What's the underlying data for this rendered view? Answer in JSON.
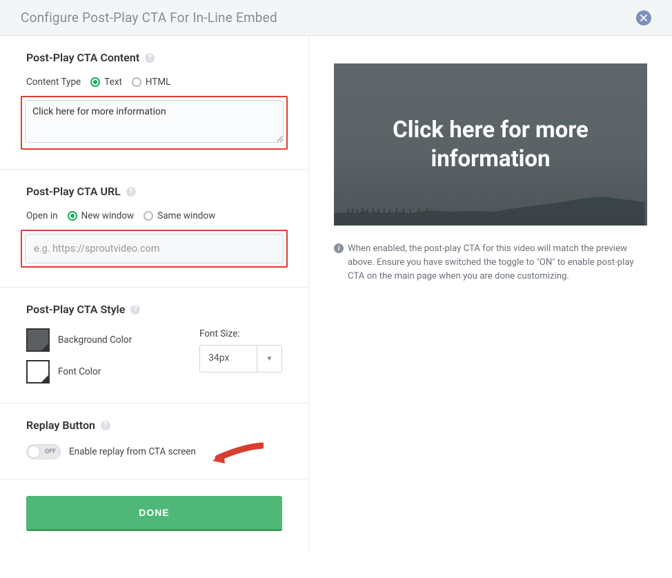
{
  "header": {
    "title": "Configure Post-Play CTA For In-Line Embed"
  },
  "ctaContent": {
    "title": "Post-Play CTA Content",
    "contentTypeLabel": "Content Type",
    "options": {
      "text": "Text",
      "html": "HTML"
    },
    "textValue": "Click here for more information"
  },
  "ctaUrl": {
    "title": "Post-Play CTA URL",
    "openInLabel": "Open in",
    "options": {
      "newWindow": "New window",
      "sameWindow": "Same window"
    },
    "placeholder": "e.g. https://sproutvideo.com"
  },
  "ctaStyle": {
    "title": "Post-Play CTA Style",
    "bgColorLabel": "Background Color",
    "fontColorLabel": "Font Color",
    "fontSizeLabel": "Font Size:",
    "fontSizeValue": "34px"
  },
  "replay": {
    "title": "Replay Button",
    "toggleState": "OFF",
    "toggleLabel": "Enable replay from CTA screen"
  },
  "footer": {
    "doneLabel": "DONE"
  },
  "preview": {
    "text": "Click here for more information",
    "infoText": "When enabled, the post-play CTA for this video will match the preview above. Ensure you have switched the toggle to \"ON\" to enable post-play CTA on the main page when you are done customizing."
  }
}
